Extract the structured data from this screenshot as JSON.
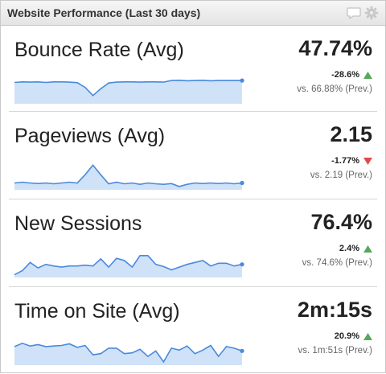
{
  "widget": {
    "title": "Website Performance (Last 30 days)",
    "icons": [
      "comment-icon",
      "gear-icon"
    ]
  },
  "colors": {
    "spark_line": "#4a89dc",
    "spark_fill": "#cfe2f8",
    "up": "#57a85b",
    "down": "#e24a4a"
  },
  "metrics": [
    {
      "title": "Bounce Rate (Avg)",
      "value": "47.74%",
      "change": "-28.6%",
      "direction": "up",
      "previous": "vs. 66.88% (Prev.)",
      "trend": [
        0.78,
        0.8,
        0.79,
        0.8,
        0.78,
        0.8,
        0.8,
        0.79,
        0.77,
        0.6,
        0.3,
        0.55,
        0.76,
        0.79,
        0.8,
        0.8,
        0.79,
        0.8,
        0.8,
        0.79,
        0.85,
        0.86,
        0.84,
        0.85,
        0.86,
        0.84,
        0.85,
        0.85,
        0.85,
        0.85
      ]
    },
    {
      "title": "Pageviews (Avg)",
      "value": "2.15",
      "change": "-1.77%",
      "direction": "down",
      "previous": "vs. 2.19 (Prev.)",
      "trend": [
        0.25,
        0.28,
        0.25,
        0.23,
        0.25,
        0.22,
        0.25,
        0.28,
        0.25,
        0.55,
        0.9,
        0.55,
        0.22,
        0.28,
        0.22,
        0.25,
        0.2,
        0.25,
        0.22,
        0.2,
        0.23,
        0.12,
        0.2,
        0.25,
        0.23,
        0.25,
        0.23,
        0.25,
        0.22,
        0.25
      ]
    },
    {
      "title": "New Sessions",
      "value": "76.4%",
      "change": "2.4%",
      "direction": "up",
      "previous": "vs. 74.6% (Prev.)",
      "trend": [
        0.1,
        0.25,
        0.55,
        0.35,
        0.48,
        0.42,
        0.38,
        0.42,
        0.42,
        0.45,
        0.42,
        0.68,
        0.38,
        0.7,
        0.62,
        0.38,
        0.8,
        0.8,
        0.48,
        0.4,
        0.28,
        0.38,
        0.48,
        0.55,
        0.62,
        0.42,
        0.52,
        0.52,
        0.42,
        0.48
      ]
    },
    {
      "title": "Time on Site (Avg)",
      "value": "2m:15s",
      "change": "20.9%",
      "direction": "up",
      "previous": "vs. 1m:51s (Prev.)",
      "trend": [
        0.68,
        0.8,
        0.7,
        0.75,
        0.68,
        0.7,
        0.72,
        0.78,
        0.65,
        0.72,
        0.38,
        0.42,
        0.62,
        0.62,
        0.42,
        0.45,
        0.58,
        0.32,
        0.52,
        0.12,
        0.62,
        0.55,
        0.7,
        0.42,
        0.55,
        0.72,
        0.32,
        0.68,
        0.62,
        0.52
      ]
    }
  ]
}
